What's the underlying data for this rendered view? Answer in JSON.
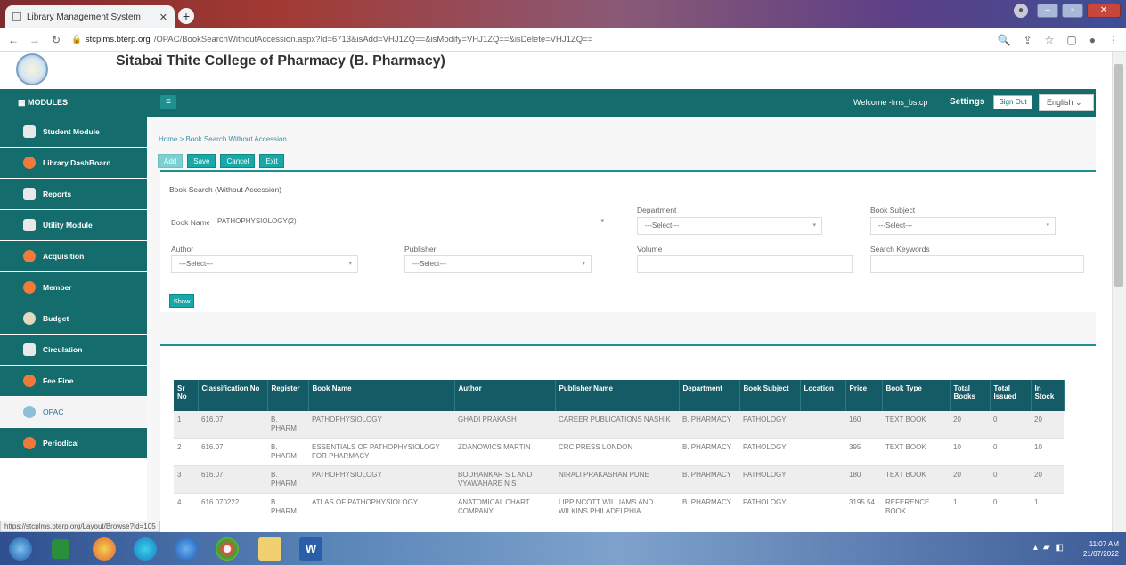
{
  "browser": {
    "tab_title": "Library Management System",
    "url_host": "stcplms.bterp.org",
    "url_path": "/OPAC/BookSearchWithoutAccession.aspx?Id=6713&isAdd=VHJ1ZQ==&isModify=VHJ1ZQ==&isDelete=VHJ1ZQ=="
  },
  "header": {
    "college": "Sitabai Thite College of Pharmacy (B. Pharmacy)",
    "modules": "MODULES",
    "welcome": "Welcome -lms_bstcp",
    "settings": "Settings",
    "signout": "Sign Out",
    "language": "English"
  },
  "sidebar": {
    "items": [
      {
        "label": "Student Module"
      },
      {
        "label": "Library DashBoard"
      },
      {
        "label": "Reports"
      },
      {
        "label": "Utility Module"
      },
      {
        "label": "Acquisition"
      },
      {
        "label": "Member"
      },
      {
        "label": "Budget"
      },
      {
        "label": "Circulation"
      },
      {
        "label": "Fee Fine"
      },
      {
        "label": "OPAC"
      },
      {
        "label": "Periodical"
      }
    ]
  },
  "breadcrumb": "Home > Book Search Without Accession",
  "buttons": {
    "add": "Add",
    "save": "Save",
    "cancel": "Cancel",
    "exit": "Exit",
    "show": "Show"
  },
  "form": {
    "title": "Book Search (Without Accession)",
    "book_name_label": "Book Name",
    "book_name_value": "PATHOPHYSIOLOGY(2)",
    "department_label": "Department",
    "department_value": "---Select---",
    "subject_label": "Book Subject",
    "subject_value": "---Select---",
    "author_label": "Author",
    "author_value": "---Select---",
    "publisher_label": "Publisher",
    "publisher_value": "---Select---",
    "volume_label": "Volume",
    "keywords_label": "Search Keywords"
  },
  "table": {
    "headers": [
      "Sr No",
      "Classification No",
      "Register",
      "Book Name",
      "Author",
      "Publisher Name",
      "Department",
      "Book Subject",
      "Location",
      "Price",
      "Book Type",
      "Total Books",
      "Total Issued",
      "In Stock"
    ],
    "rows": [
      [
        "1",
        "616.07",
        "B. PHARM",
        "PATHOPHYSIOLOGY",
        "GHADI PRAKASH",
        "CAREER PUBLICATIONS NASHIK",
        "B. PHARMACY",
        "PATHOLOGY",
        "",
        "160",
        "TEXT BOOK",
        "20",
        "0",
        "20"
      ],
      [
        "2",
        "616.07",
        "B. PHARM",
        "ESSENTIALS OF PATHOPHYSIOLOGY FOR PHARMACY",
        "ZDANOWICS MARTIN",
        "CRC PRESS LONDON",
        "B. PHARMACY",
        "PATHOLOGY",
        "",
        "395",
        "TEXT BOOK",
        "10",
        "0",
        "10"
      ],
      [
        "3",
        "616.07",
        "B. PHARM",
        "PATHOPHYSIOLOGY",
        "BODHANKAR S L AND VYAWAHARE N S",
        "NIRALI PRAKASHAN PUNE",
        "B. PHARMACY",
        "PATHOLOGY",
        "",
        "180",
        "TEXT BOOK",
        "20",
        "0",
        "20"
      ],
      [
        "4",
        "616.070222",
        "B. PHARM",
        "ATLAS OF PATHOPHYSIOLOGY",
        "ANATOMICAL CHART COMPANY",
        "LIPPINCOTT WILLIAMS AND WILKINS PHILADELPHIA",
        "B. PHARMACY",
        "PATHOLOGY",
        "",
        "3195.54",
        "REFERENCE BOOK",
        "1",
        "0",
        "1"
      ]
    ]
  },
  "status_url": "https://stcplms.bterp.org/Layout/Browse?Id=105",
  "taskbar": {
    "time": "11:07 AM",
    "date": "21/07/2022"
  }
}
